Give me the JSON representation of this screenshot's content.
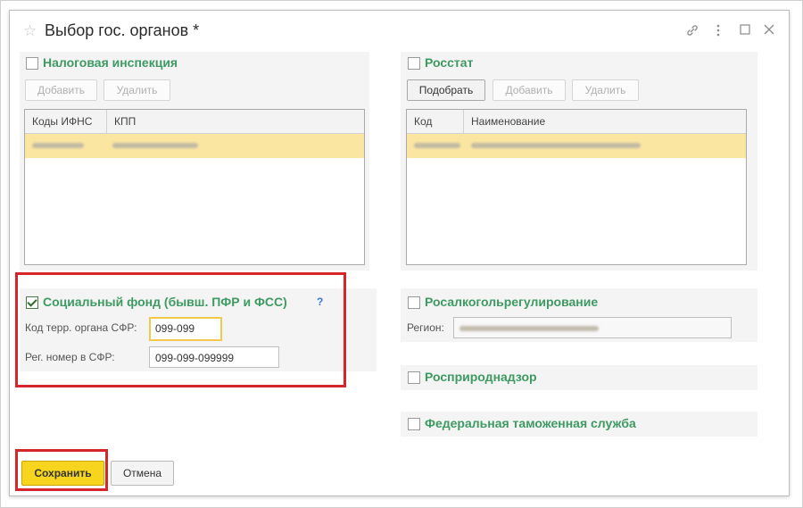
{
  "dialog": {
    "title": "Выбор гос. органов *",
    "icons": [
      "link-icon",
      "more-icon",
      "maximize-icon",
      "close-icon"
    ]
  },
  "tax": {
    "title": "Налоговая инспекция",
    "checked": false,
    "add_label": "Добавить",
    "delete_label": "Удалить",
    "columns": [
      "Коды ИФНС",
      "КПП"
    ]
  },
  "rosstat": {
    "title": "Росстат",
    "checked": false,
    "pick_label": "Подобрать",
    "add_label": "Добавить",
    "delete_label": "Удалить",
    "columns": [
      "Код",
      "Наименование"
    ]
  },
  "sfr": {
    "title": "Социальный фонд (бывш. ПФР и ФСС)",
    "checked": true,
    "help": "?",
    "terr_label": "Код терр. органа СФР:",
    "terr_value": "099-099",
    "reg_label": "Рег. номер в СФР:",
    "reg_value": "099-099-099999"
  },
  "rosalko": {
    "title": "Росалкогольрегулирование",
    "checked": false,
    "region_label": "Регион:"
  },
  "rosprirod": {
    "title": "Росприроднадзор",
    "checked": false
  },
  "fts": {
    "title": "Федеральная таможенная служба",
    "checked": false
  },
  "footer": {
    "save_label": "Сохранить",
    "cancel_label": "Отмена"
  },
  "colors": {
    "accent_green": "#3e9a62",
    "highlight_red": "#d6262b",
    "primary_yellow": "#f7d51e",
    "row_selected": "#fbe6a1"
  }
}
